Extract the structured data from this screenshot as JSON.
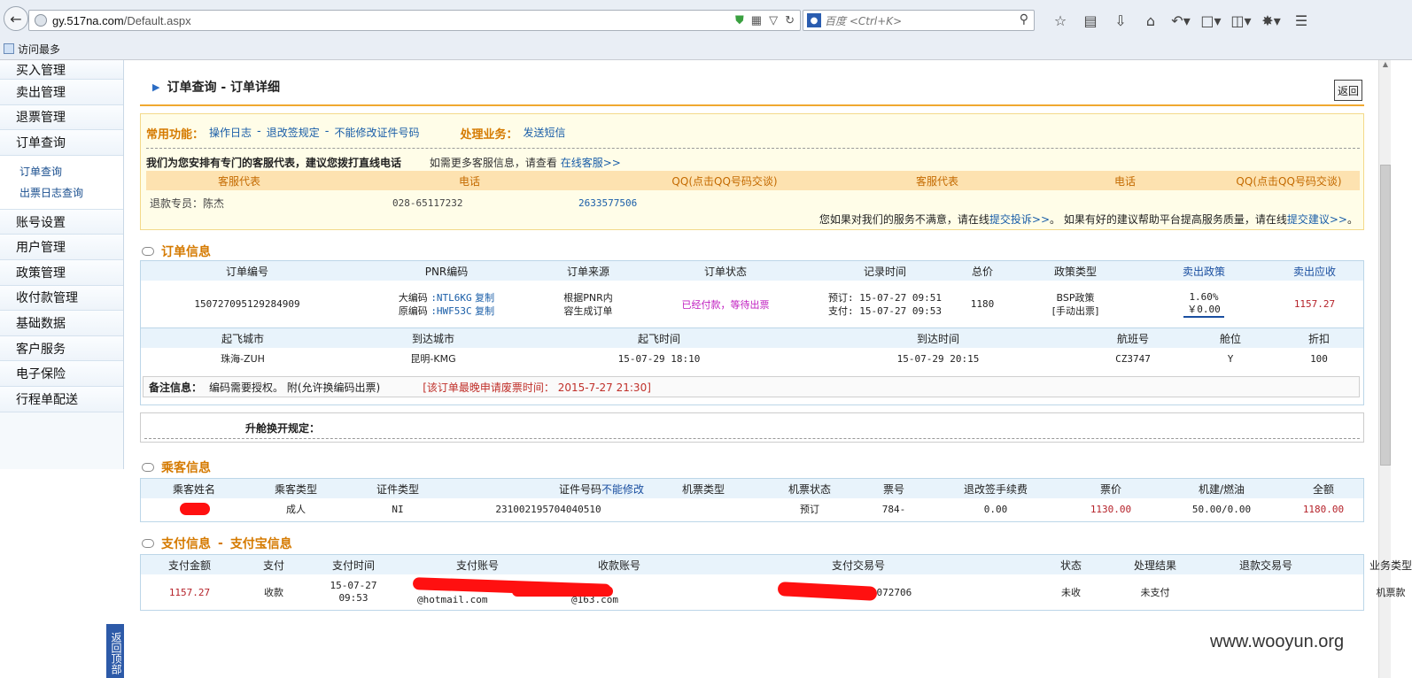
{
  "browser": {
    "url_host": "gy.517na.com",
    "url_path": "/Default.aspx",
    "search_placeholder": "百度 <Ctrl+K>",
    "bookmark_label": "访问最多"
  },
  "sidebar": {
    "items_top": [
      "买入管理",
      "卖出管理",
      "退票管理",
      "订单查询"
    ],
    "subitems": [
      "订单查询",
      "出票日志查询"
    ],
    "items_bottom": [
      "账号设置",
      "用户管理",
      "政策管理",
      "收付款管理",
      "基础数据",
      "客户服务",
      "电子保险",
      "行程单配送"
    ],
    "back_top": "返回顶部"
  },
  "page": {
    "title": "订单查询 - 订单详细",
    "back_button": "返回"
  },
  "functions": {
    "common_label": "常用功能：",
    "links": [
      "操作日志",
      "退改签规定",
      "不能修改证件号码"
    ],
    "separators": [
      "-",
      "-"
    ],
    "process_label": "处理业务：",
    "process_link": "发送短信",
    "cs_note": "我们为您安排有专门的客服代表，建议您拨打直线电话",
    "cs_more": "如需更多客服信息，请查看",
    "cs_online": "在线客服>>",
    "cs_headers": [
      "客服代表",
      "电话",
      "QQ(点击QQ号码交谈)",
      "客服代表",
      "电话",
      "QQ(点击QQ号码交谈)"
    ],
    "cs_row": {
      "rep": "退款专员：陈杰",
      "phone": "028-65117232",
      "qq": "2633577506"
    },
    "complaint_text": "您如果对我们的服务不满意，请在线",
    "complaint_link": "提交投诉>>",
    "complaint_mid": "。 如果有好的建议帮助平台提高服务质量，请在线",
    "suggest_link": "提交建议>>",
    "complaint_end": "。"
  },
  "order_info": {
    "title": "订单信息",
    "headers": [
      "订单编号",
      "PNR编码",
      "订单来源",
      "订单状态",
      "记录时间",
      "总价",
      "政策类型",
      "卖出政策",
      "卖出应收"
    ],
    "row": {
      "order_no": "150727095129284909",
      "pnr_big_label": "大编码",
      "pnr_big": ":NTL6KG",
      "pnr_orig_label": "原编码",
      "pnr_orig": ":HWF53C",
      "copy": "复制",
      "source_1": "根据PNR内",
      "source_2": "容生成订单",
      "status": "已经付款，等待出票",
      "book_time": "预订: 15-07-27 09:51",
      "pay_time": "支付: 15-07-27 09:53",
      "total": "1180",
      "policy_1": "BSP政策",
      "policy_2": "[手动出票]",
      "sell_policy_rate": "1.60%",
      "sell_policy_amt": "￥0.00",
      "receivable": "1157.27"
    },
    "flight_headers": [
      "起飞城市",
      "到达城市",
      "起飞时间",
      "到达时间",
      "航班号",
      "舱位",
      "折扣"
    ],
    "flight_row": [
      "珠海-ZUH",
      "昆明-KMG",
      "15-07-29 18:10",
      "15-07-29 20:15",
      "CZ3747",
      "Y",
      "100"
    ],
    "remark_label": "备注信息：",
    "remark_text": "编码需要授权。 附(允许换编码出票)",
    "remark_deadline": "[该订单最晚申请废票时间： 2015-7-27 21:30]",
    "upgrade_label": "升舱换开规定："
  },
  "passenger_info": {
    "title": "乘客信息",
    "headers": [
      "乘客姓名",
      "乘客类型",
      "证件类型",
      "证件号码",
      "不能修改",
      "机票类型",
      "机票状态",
      "票号",
      "退改签手续费",
      "票价",
      "机建/燃油",
      "全额"
    ],
    "row": [
      "",
      "成人",
      "NI",
      "231002195704040510",
      "",
      "预订",
      "784-",
      "0.00",
      "1130.00",
      "50.00/0.00",
      "1180.00"
    ]
  },
  "payment_info": {
    "title": "支付信息",
    "subtitle": "支付宝信息",
    "dash": "-",
    "headers": [
      "支付金额",
      "支付",
      "支付时间",
      "支付账号",
      "收款账号",
      "支付交易号",
      "状态",
      "处理结果",
      "退款交易号",
      "业务类型"
    ],
    "row": {
      "amount": "1157.27",
      "type": "收款",
      "time_1": "15-07-27",
      "time_2": "09:53",
      "pay_account": "@hotmail.com",
      "recv_account": "@163.com",
      "trade_no": "2015072706",
      "status": "未收",
      "result": "未支付",
      "refund_no": "",
      "biz": "机票款"
    }
  },
  "watermark": "www.wooyun.org"
}
